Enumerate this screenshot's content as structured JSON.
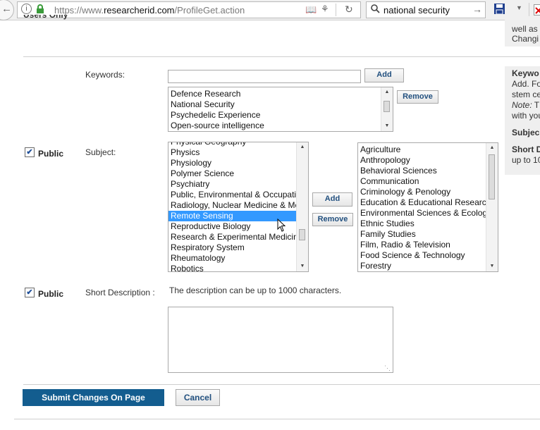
{
  "browser": {
    "url_prefix": "https://www.",
    "url_domain": "researcherid.com",
    "url_path": "/ProfileGet.action",
    "search_query": "national security"
  },
  "top_cut": "Users Only",
  "sidebar": {
    "top_line1": "well as",
    "top_line2": "Changi",
    "keywords_title": "Keywo",
    "keywords_line2": "Add. Fo",
    "keywords_line3": "stem ce",
    "keywords_note": "Note:",
    "keywords_note_rest": " T",
    "keywords_line5": "with you",
    "subject_title": "Subjec",
    "short_desc_title": "Short D",
    "short_desc_line": "up to 10"
  },
  "keywords": {
    "label": "Keywords:",
    "input_value": "",
    "add_label": "Add",
    "remove_label": "Remove",
    "items": [
      "Defence Research",
      "National Security",
      "Psychedelic Experience",
      "Open-source intelligence"
    ]
  },
  "subject": {
    "public_label": "Public",
    "label": "Subject:",
    "add_label": "Add",
    "remove_label": "Remove",
    "available": [
      "Physical Geography",
      "Physics",
      "Physiology",
      "Polymer Science",
      "Psychiatry",
      "Public, Environmental & Occupational Health",
      "Radiology, Nuclear Medicine & Medical Imaging",
      "Remote Sensing",
      "Reproductive Biology",
      "Research & Experimental Medicine",
      "Respiratory System",
      "Rheumatology",
      "Robotics"
    ],
    "selected_available": "Remote Sensing",
    "chosen": [
      "Agriculture",
      "Anthropology",
      "Behavioral Sciences",
      "Communication",
      "Criminology & Penology",
      "Education & Educational Research",
      "Environmental Sciences & Ecology",
      "Ethnic Studies",
      "Family Studies",
      "Film, Radio & Television",
      "Food Science & Technology",
      "Forestry"
    ]
  },
  "short_description": {
    "public_label": "Public",
    "label": "Short Description :",
    "hint": "The description can be up to 1000 characters.",
    "value": ""
  },
  "actions": {
    "submit_label": "Submit Changes On Page",
    "cancel_label": "Cancel"
  },
  "colors": {
    "submit_bg": "#135d8f",
    "selection": "#3399ff",
    "button_text": "#22507f"
  }
}
